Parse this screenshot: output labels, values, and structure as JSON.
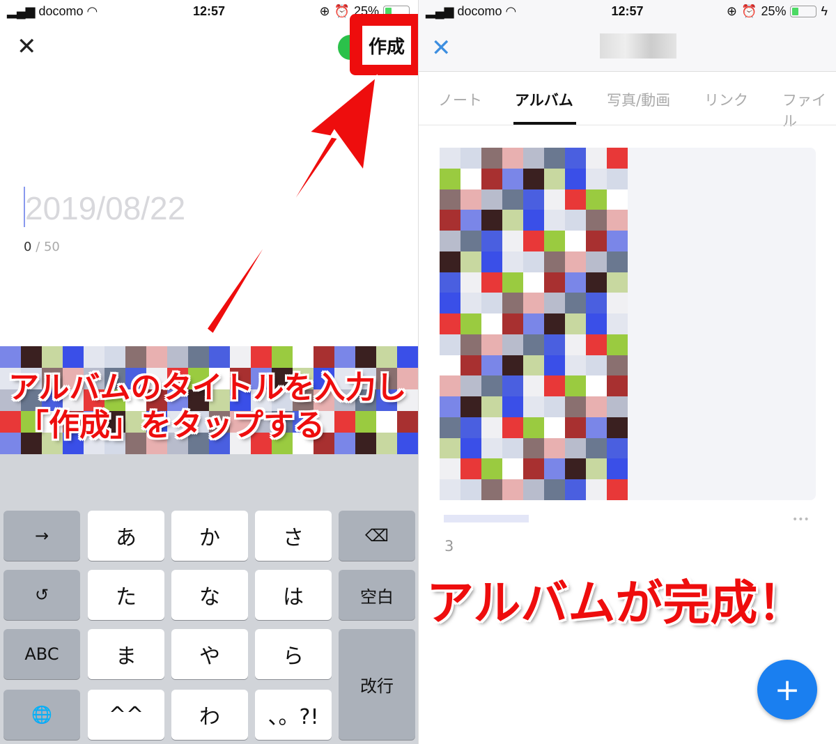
{
  "left": {
    "status": {
      "carrier": "docomo",
      "time": "12:57",
      "battery": "25%"
    },
    "create_button": "作成",
    "title_placeholder": "2019/08/22",
    "char_count": "0",
    "char_max": "/ 50",
    "keyboard": {
      "rows": [
        [
          "→",
          "あ",
          "か",
          "さ",
          "⌫"
        ],
        [
          "↺",
          "た",
          "な",
          "は",
          "空白"
        ],
        [
          "ABC",
          "ま",
          "や",
          "ら",
          "改行"
        ],
        [
          "🌐",
          "^^",
          "わ",
          "、。?!"
        ]
      ]
    }
  },
  "right": {
    "status": {
      "carrier": "docomo",
      "time": "12:57",
      "battery": "25%"
    },
    "tabs": [
      "ノート",
      "アルバム",
      "写真/動画",
      "リンク",
      "ファイル"
    ],
    "active_tab": "アルバム",
    "album_count": "3",
    "more": "•••",
    "fab": "+"
  },
  "annotations": {
    "left_line1": "アルバムのタイトルを入力し",
    "left_line2": "「作成」をタップする",
    "right": "アルバムが完成！"
  },
  "colors": {
    "accent_red": "#ee0d0d",
    "fab_blue": "#1a7ff0",
    "line_green": "#2bc14a"
  }
}
